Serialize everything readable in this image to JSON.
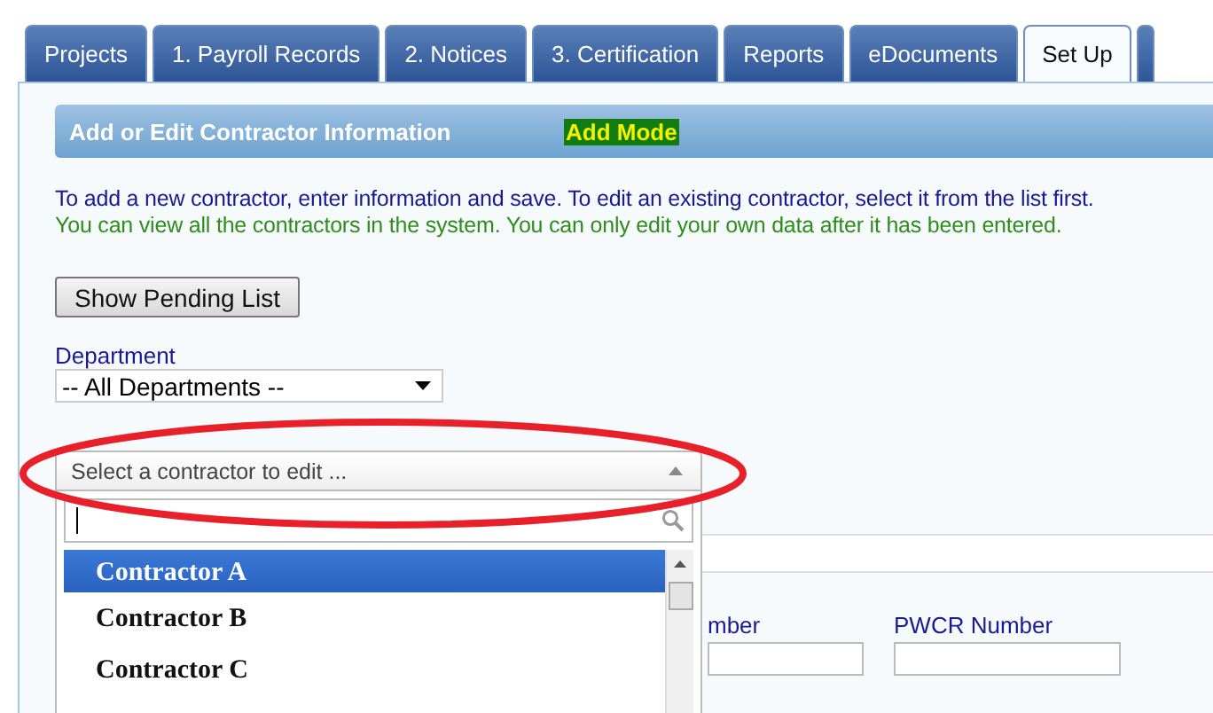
{
  "tabs": [
    {
      "label": "Projects",
      "selected": false
    },
    {
      "label": "1. Payroll Records",
      "selected": false
    },
    {
      "label": "2. Notices",
      "selected": false
    },
    {
      "label": "3. Certification",
      "selected": false
    },
    {
      "label": "Reports",
      "selected": false
    },
    {
      "label": "eDocuments",
      "selected": false
    },
    {
      "label": "Set Up",
      "selected": true
    }
  ],
  "header": {
    "title": "Add or Edit Contractor Information",
    "mode": "Add Mode"
  },
  "instructions": [
    "To add a new contractor, enter information and save. To edit an existing contractor, select it from the list first.",
    "You can view all the contractors in the system. You can only edit your own data after it has been entered."
  ],
  "pending_button": "Show Pending List",
  "department": {
    "label": "Department",
    "value": "-- All Departments --"
  },
  "contractor_select": {
    "placeholder": "Select a contractor to edit ...",
    "expanded": true,
    "options": [
      {
        "label": "Contractor A",
        "selected": true
      },
      {
        "label": "Contractor B",
        "selected": false
      },
      {
        "label": "Contractor C",
        "selected": false
      }
    ]
  },
  "fields": [
    {
      "label": "mber"
    },
    {
      "label": "PWCR Number"
    }
  ]
}
